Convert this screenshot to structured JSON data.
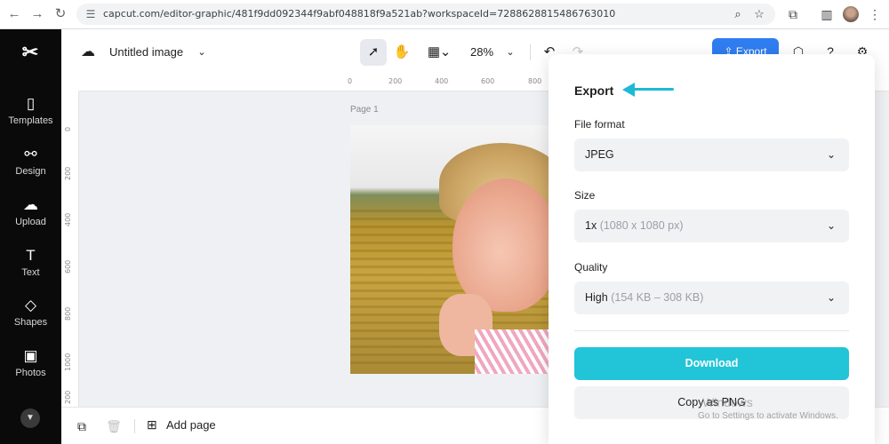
{
  "browser": {
    "url": "capcut.com/editor-graphic/481f9dd092344f9abf048818f9a521ab?workspaceId=7288628815486763010",
    "icons": [
      "back-icon",
      "forward-icon",
      "reload-icon",
      "site-settings-icon",
      "zoom-icon",
      "star-icon",
      "extensions-icon",
      "sidepanel-icon",
      "profile-avatar",
      "menu-icon"
    ]
  },
  "sidebar": {
    "items": [
      {
        "label": "Templates",
        "icon": "templates-icon"
      },
      {
        "label": "Design",
        "icon": "design-icon"
      },
      {
        "label": "Upload",
        "icon": "upload-icon"
      },
      {
        "label": "Text",
        "icon": "text-icon"
      },
      {
        "label": "Shapes",
        "icon": "shapes-icon"
      },
      {
        "label": "Photos",
        "icon": "photos-icon"
      }
    ]
  },
  "topbar": {
    "title": "Untitled image",
    "zoom": "28%",
    "export_label": "Export"
  },
  "canvas": {
    "page_label": "Page 1",
    "ruler_top": [
      "0",
      "200",
      "400",
      "600",
      "800"
    ],
    "ruler_left": [
      "0",
      "200",
      "400",
      "600",
      "800",
      "1000",
      "200"
    ]
  },
  "bottombar": {
    "add_page_label": "Add page"
  },
  "export_panel": {
    "title": "Export",
    "file_format_label": "File format",
    "file_format_value": "JPEG",
    "size_label": "Size",
    "size_value": "1x",
    "size_hint": "(1080 x 1080 px)",
    "quality_label": "Quality",
    "quality_value": "High",
    "quality_hint": "(154 KB – 308 KB)",
    "download_label": "Download",
    "copy_label": "Copy as PNG",
    "arrow_color": "#1fb8d9",
    "download_color": "#22c4d8"
  },
  "watermark": {
    "title": "Windows",
    "subtitle": "Go to Settings to activate Windows."
  }
}
